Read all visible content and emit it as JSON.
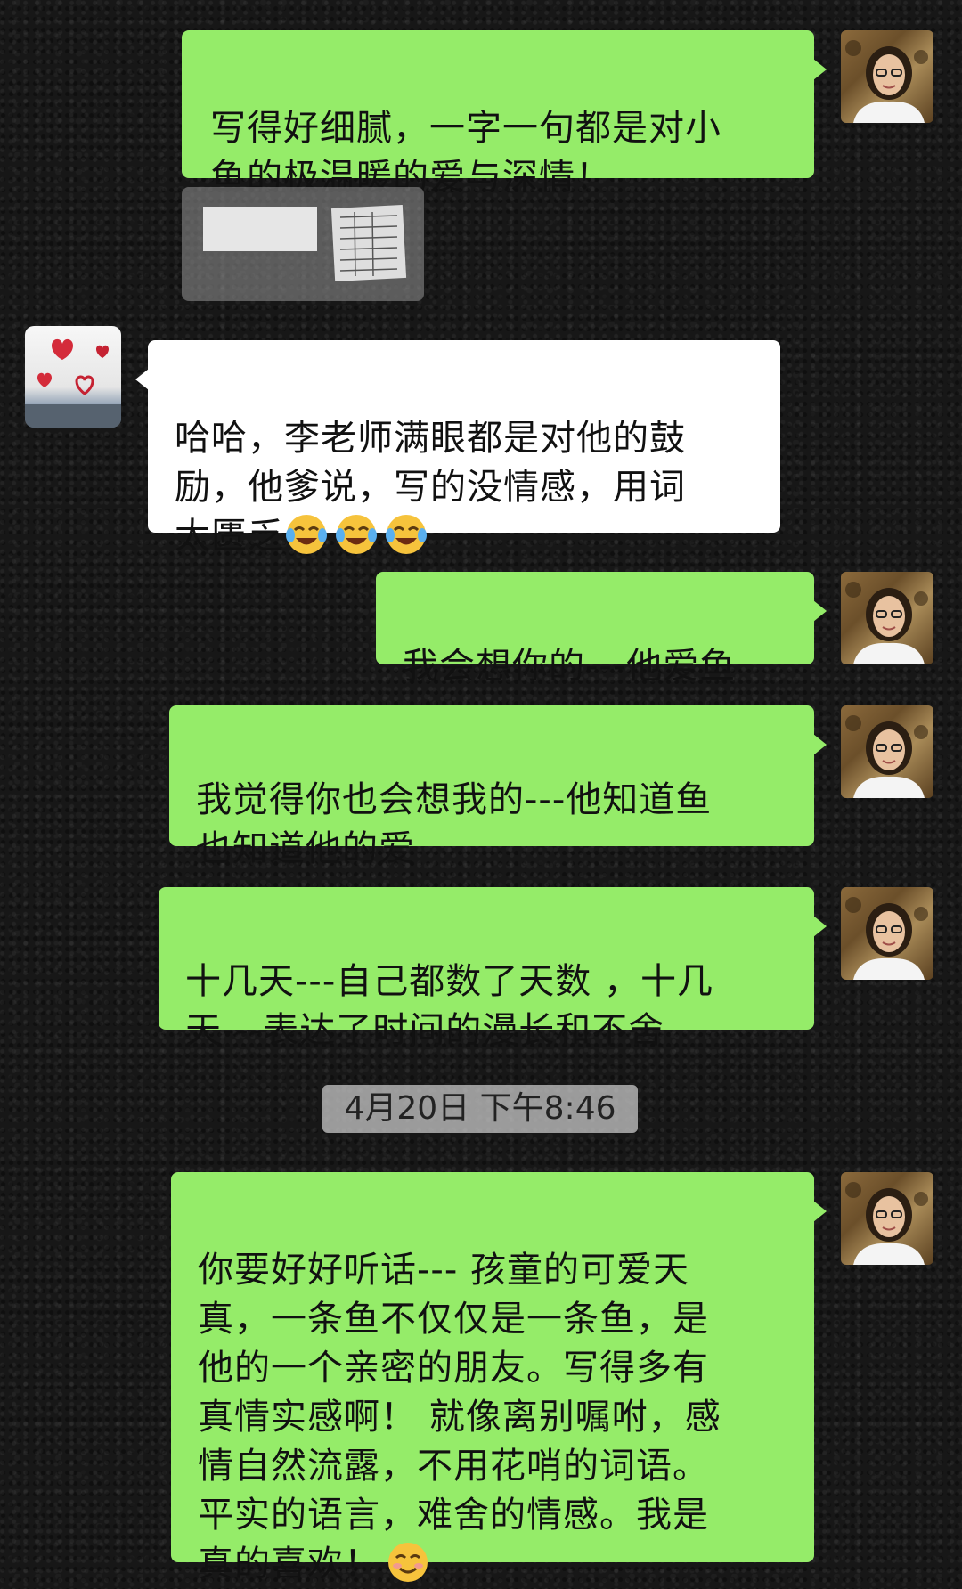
{
  "messages": [
    {
      "id": "m1",
      "sender": "me",
      "text": "写得好细腻，一字一句都是对小\n鱼的极温暖的爱与深情！"
    },
    {
      "id": "m2",
      "sender": "other",
      "text": "哈哈，李老师满眼都是对他的鼓\n励，他爹说，写的没情感，用词\n太匮乏",
      "emojis": [
        "face-with-tears-of-joy",
        "face-with-tears-of-joy",
        "face-with-tears-of-joy"
      ]
    },
    {
      "id": "m3",
      "sender": "me",
      "text": "我会想你的---他爱鱼"
    },
    {
      "id": "m4",
      "sender": "me",
      "text": "我觉得你也会想我的---他知道鱼\n也知道他的爱"
    },
    {
      "id": "m5",
      "sender": "me",
      "text": "十几天---自己都数了天数 ，十几\n天---表达了时间的漫长和不舍"
    },
    {
      "id": "m6",
      "sender": "me",
      "text": "你要好好听话--- 孩童的可爱天\n真，一条鱼不仅仅是一条鱼，是\n他的一个亲密的朋友。写得多有\n真情实感啊！ 就像离别嘱咐，感\n情自然流露，不用花哨的词语。\n平实的语言，难舍的情感。我是\n真的喜欢！",
      "emojis": [
        "smiling-face"
      ]
    }
  ],
  "timestamp": "4月20日 下午8:46",
  "colors": {
    "my_bubble": "#95ec69",
    "other_bubble": "#ffffff",
    "time_badge": "#c8c8c8"
  }
}
